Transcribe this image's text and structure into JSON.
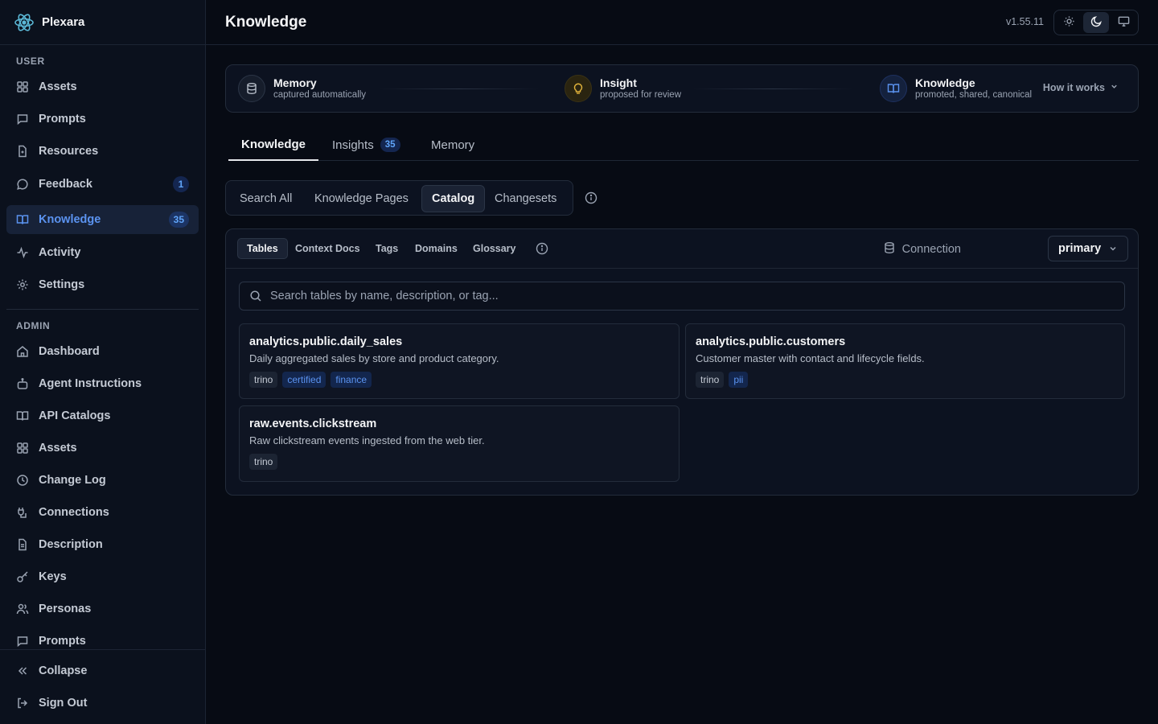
{
  "app": {
    "name": "Plexara",
    "version": "v1.55.11"
  },
  "header": {
    "title": "Knowledge"
  },
  "sidebar": {
    "user_label": "USER",
    "user_items": [
      {
        "label": "Assets",
        "icon": "grid-icon"
      },
      {
        "label": "Prompts",
        "icon": "message-square-icon"
      },
      {
        "label": "Resources",
        "icon": "file-icon"
      },
      {
        "label": "Feedback",
        "icon": "message-circle-icon",
        "badge": "1"
      },
      {
        "label": "Knowledge",
        "icon": "book-open-icon",
        "badge": "35",
        "active": true
      },
      {
        "label": "Activity",
        "icon": "activity-icon"
      },
      {
        "label": "Settings",
        "icon": "gear-icon"
      }
    ],
    "admin_label": "ADMIN",
    "admin_items": [
      {
        "label": "Dashboard",
        "icon": "home-icon"
      },
      {
        "label": "Agent Instructions",
        "icon": "bot-icon"
      },
      {
        "label": "API Catalogs",
        "icon": "book-open-icon"
      },
      {
        "label": "Assets",
        "icon": "grid-icon"
      },
      {
        "label": "Change Log",
        "icon": "clock-icon"
      },
      {
        "label": "Connections",
        "icon": "plug-icon"
      },
      {
        "label": "Description",
        "icon": "file-text-icon"
      },
      {
        "label": "Keys",
        "icon": "key-icon"
      },
      {
        "label": "Personas",
        "icon": "users-icon"
      },
      {
        "label": "Prompts",
        "icon": "message-square-icon"
      }
    ],
    "collapse_label": "Collapse",
    "signout_label": "Sign Out"
  },
  "pipeline": {
    "stages": [
      {
        "title": "Memory",
        "subtitle": "captured automatically",
        "icon": "database-icon"
      },
      {
        "title": "Insight",
        "subtitle": "proposed for review",
        "icon": "lightbulb-icon"
      },
      {
        "title": "Knowledge",
        "subtitle": "promoted, shared, canonical",
        "icon": "book-open-icon"
      }
    ],
    "how_it_works": "How it works"
  },
  "main_tabs": [
    {
      "label": "Knowledge",
      "active": true
    },
    {
      "label": "Insights",
      "badge": "35"
    },
    {
      "label": "Memory"
    }
  ],
  "sub_tabs": [
    {
      "label": "Search All"
    },
    {
      "label": "Knowledge Pages"
    },
    {
      "label": "Catalog",
      "active": true
    },
    {
      "label": "Changesets"
    }
  ],
  "catalog": {
    "tabs": [
      {
        "label": "Tables",
        "active": true
      },
      {
        "label": "Context Docs"
      },
      {
        "label": "Tags"
      },
      {
        "label": "Domains"
      },
      {
        "label": "Glossary"
      }
    ],
    "connection_label": "Connection",
    "connection_value": "primary",
    "search_placeholder": "Search tables by name, description, or tag...",
    "tables": [
      {
        "name": "analytics.public.daily_sales",
        "description": "Daily aggregated sales by store and product category.",
        "tags": [
          "trino",
          "certified",
          "finance"
        ]
      },
      {
        "name": "analytics.public.customers",
        "description": "Customer master with contact and lifecycle fields.",
        "tags": [
          "trino",
          "pii"
        ]
      },
      {
        "name": "raw.events.clickstream",
        "description": "Raw clickstream events ingested from the web tier.",
        "tags": [
          "trino"
        ]
      }
    ]
  },
  "colors": {
    "background": "#070b14",
    "sidebar": "#0b111d",
    "accent": "#5b93f0",
    "badge_bg": "#142650"
  }
}
